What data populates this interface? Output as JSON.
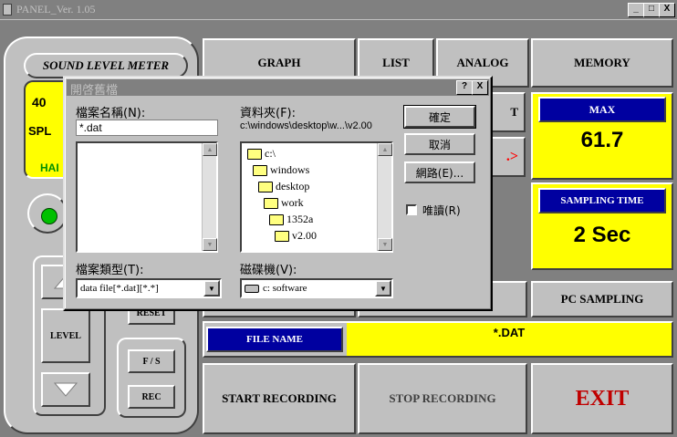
{
  "window": {
    "title": "PANEL_Ver. 1.05",
    "buttons": [
      "_",
      "□",
      "X"
    ]
  },
  "left_panel": {
    "header": "SOUND LEVEL METER",
    "display_value_fragment": "40",
    "display_label": "SPL",
    "display_sub": "HAI",
    "level_label": "LEVEL",
    "reset_label": "RESET",
    "fs_label": "F / S",
    "rec_label": "REC"
  },
  "top_tabs": [
    {
      "label": "GRAPH"
    },
    {
      "label": "LIST"
    },
    {
      "label": "ANALOG"
    },
    {
      "label": "MEMORY"
    }
  ],
  "readouts": {
    "max_label": "MAX",
    "max_value": "61.7",
    "sampling_label": "SAMPLING TIME",
    "sampling_value": "2 Sec",
    "pc_sampling": "PC SAMPLING",
    "hidden_btn_fragment": "T",
    "arrow_fragment": ".>"
  },
  "file": {
    "label": "FILE NAME",
    "value": "*.DAT"
  },
  "bottom_buttons": {
    "start": "START RECORDING",
    "stop": "STOP RECORDING",
    "exit": "EXIT"
  },
  "colors": {
    "yellow": "#ffff00",
    "blue": "#0000a0",
    "exit_red": "#c00000"
  },
  "dialog": {
    "title": "開啓舊檔",
    "help": "?",
    "close": "X",
    "filename_label": "檔案名稱(N):",
    "filename_value": "*.dat",
    "folders_label": "資料夾(F):",
    "folders_path": "c:\\windows\\desktop\\w...\\v2.00",
    "folder_tree": [
      "c:\\",
      "windows",
      "desktop",
      "work",
      "1352a",
      "v2.00"
    ],
    "ok": "確定",
    "cancel": "取消",
    "network": "網路(E)...",
    "readonly": "唯讀(R)",
    "filetype_label": "檔案類型(T):",
    "filetype_value": "data file[*.dat][*.*]",
    "drives_label": "磁碟機(V):",
    "drives_value": "c: software"
  }
}
